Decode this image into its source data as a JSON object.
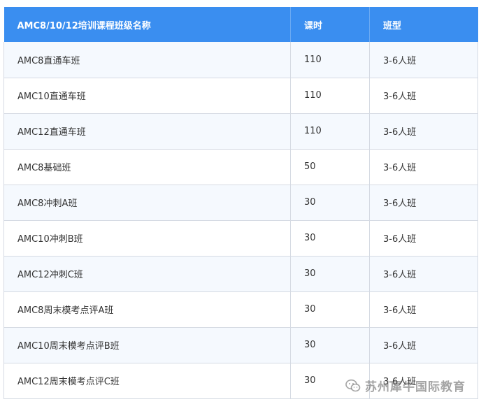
{
  "table": {
    "headers": [
      "AMC8/10/12培训课程班级名称",
      "课时",
      "班型"
    ],
    "rows": [
      [
        "AMC8直通车班",
        "110",
        "3-6人班"
      ],
      [
        "AMC10直通车班",
        "110",
        "3-6人班"
      ],
      [
        "AMC12直通车班",
        "110",
        "3-6人班"
      ],
      [
        "AMC8基础班",
        "50",
        "3-6人班"
      ],
      [
        "AMC8冲刺A班",
        "30",
        "3-6人班"
      ],
      [
        "AMC10冲刺B班",
        "30",
        "3-6人班"
      ],
      [
        "AMC12冲刺C班",
        "30",
        "3-6人班"
      ],
      [
        "AMC8周末模考点评A班",
        "30",
        "3-6人班"
      ],
      [
        "AMC10周末模考点评B班",
        "30",
        "3-6人班"
      ],
      [
        "AMC12周末模考点评C班",
        "30",
        "3-6人班"
      ]
    ]
  },
  "watermark": {
    "text": "苏州犀牛国际教育",
    "icon": "wechat-icon"
  },
  "colors": {
    "header_bg": "#3a8ef0",
    "header_text": "#ffffff",
    "row_alt_bg": "#f5f9fe",
    "border": "#d5dae3"
  }
}
